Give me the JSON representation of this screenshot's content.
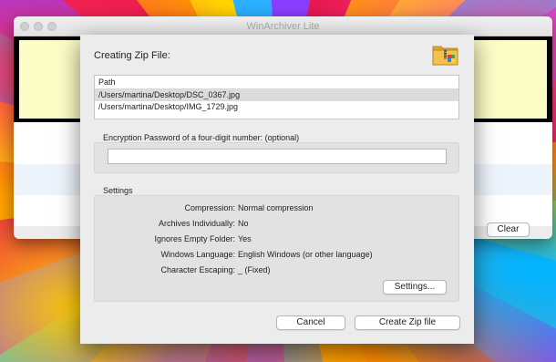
{
  "app": {
    "title": "WinArchiver Lite",
    "clear_label": "Clear"
  },
  "dialog": {
    "title": "Creating Zip File:",
    "path_header": "Path",
    "paths": [
      "/Users/martina/Desktop/DSC_0367.jpg",
      "/Users/martina/Desktop/IMG_1729.jpg"
    ],
    "encryption_label": "Encryption Password of a four-digit number: (optional)",
    "password_value": "",
    "settings_label": "Settings",
    "settings": [
      {
        "key": "Compression:",
        "value": "Normal compression"
      },
      {
        "key": "Archives Individually:",
        "value": "No"
      },
      {
        "key": "Ignores Empty Folder:",
        "value": "Yes"
      },
      {
        "key": "Windows Language:",
        "value": "English Windows (or other language)"
      },
      {
        "key": "Character Escaping:",
        "value": "_ (Fixed)"
      }
    ],
    "settings_button": "Settings...",
    "cancel_button": "Cancel",
    "create_button": "Create Zip file"
  },
  "icons": {
    "archive": "folder-zip-icon"
  }
}
